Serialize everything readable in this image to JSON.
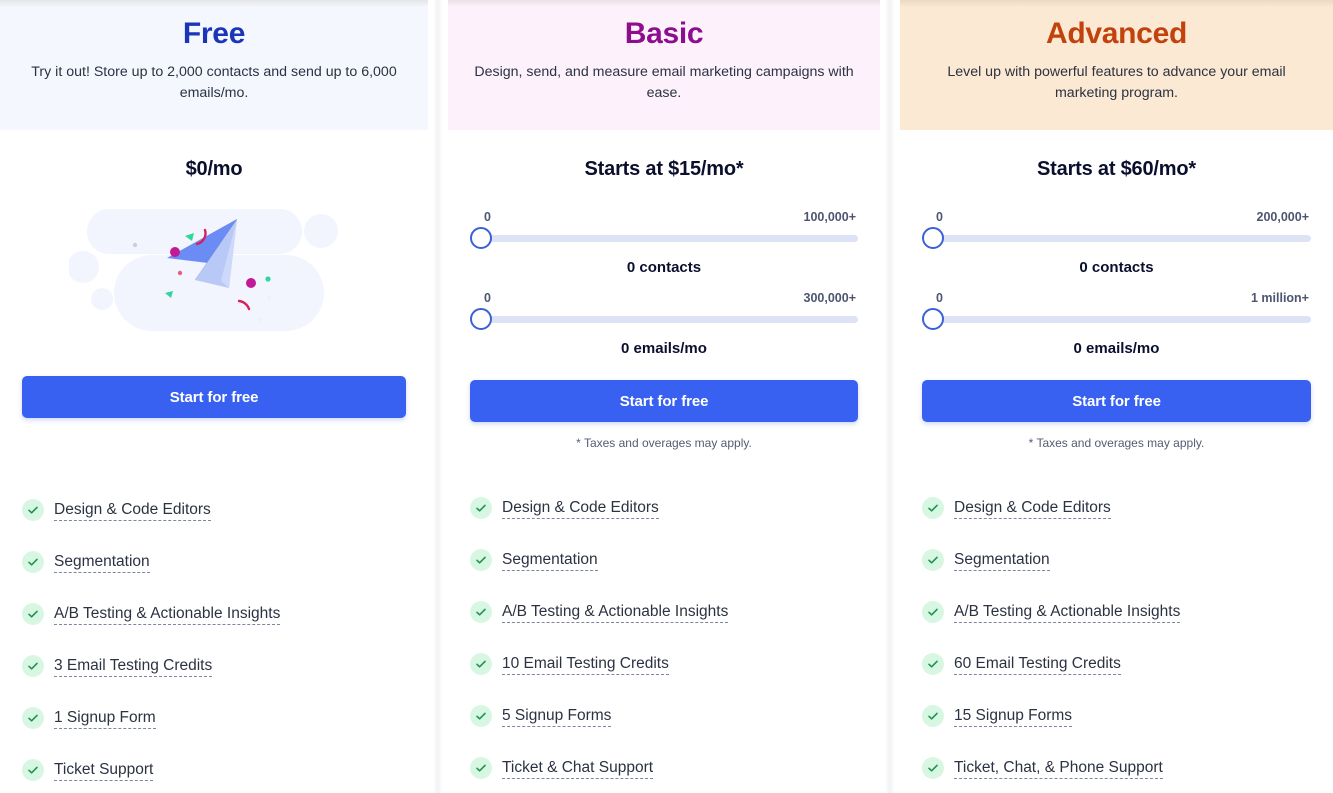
{
  "plans": [
    {
      "id": "free",
      "title": "Free",
      "title_color": "#1b35b8",
      "header_bg": "#f4f7fe",
      "description": "Try it out! Store up to 2,000 contacts and send up to 6,000 emails/mo.",
      "price": "$0/mo",
      "illustration": "paper-plane-illustration",
      "cta_label": "Start for free",
      "taxes_note": "",
      "sliders": [],
      "features": [
        "Design & Code Editors",
        "Segmentation",
        "A/B Testing & Actionable Insights",
        "3 Email Testing Credits",
        "1 Signup Form",
        "Ticket Support"
      ]
    },
    {
      "id": "basic",
      "title": "Basic",
      "title_color": "#8c0d8e",
      "header_bg": "#fdf2fb",
      "description": "Design, send, and measure email marketing campaigns with ease.",
      "price": "Starts at $15/mo*",
      "cta_label": "Start for free",
      "taxes_note": "* Taxes and overages may apply.",
      "sliders": [
        {
          "name": "contacts",
          "min_label": "0",
          "max_label": "100,000+",
          "value_label": "0 contacts",
          "position_pct": 0
        },
        {
          "name": "emails",
          "min_label": "0",
          "max_label": "300,000+",
          "value_label": "0 emails/mo",
          "position_pct": 0
        }
      ],
      "features": [
        "Design & Code Editors",
        "Segmentation",
        "A/B Testing & Actionable Insights",
        "10 Email Testing Credits",
        "5 Signup Forms",
        "Ticket & Chat Support"
      ]
    },
    {
      "id": "advanced",
      "title": "Advanced",
      "title_color": "#c2420d",
      "header_bg": "#fce9d4",
      "description": "Level up with powerful features to advance your email marketing program.",
      "price": "Starts at $60/mo*",
      "cta_label": "Start for free",
      "taxes_note": "* Taxes and overages may apply.",
      "sliders": [
        {
          "name": "contacts",
          "min_label": "0",
          "max_label": "200,000+",
          "value_label": "0 contacts",
          "position_pct": 0
        },
        {
          "name": "emails",
          "min_label": "0",
          "max_label": "1 million+",
          "value_label": "0 emails/mo",
          "position_pct": 0
        }
      ],
      "features": [
        "Design & Code Editors",
        "Segmentation",
        "A/B Testing & Actionable Insights",
        "60 Email Testing Credits",
        "15 Signup Forms",
        "Ticket, Chat, & Phone Support"
      ]
    }
  ],
  "colors": {
    "cta_blue": "#3861f2",
    "slider_track": "#dde3f5",
    "slider_thumb_ring": "#3a62d6",
    "check_badge_bg": "#d8f7e3",
    "check_mark": "#1f9254"
  },
  "icons": {
    "check": "check-icon"
  }
}
